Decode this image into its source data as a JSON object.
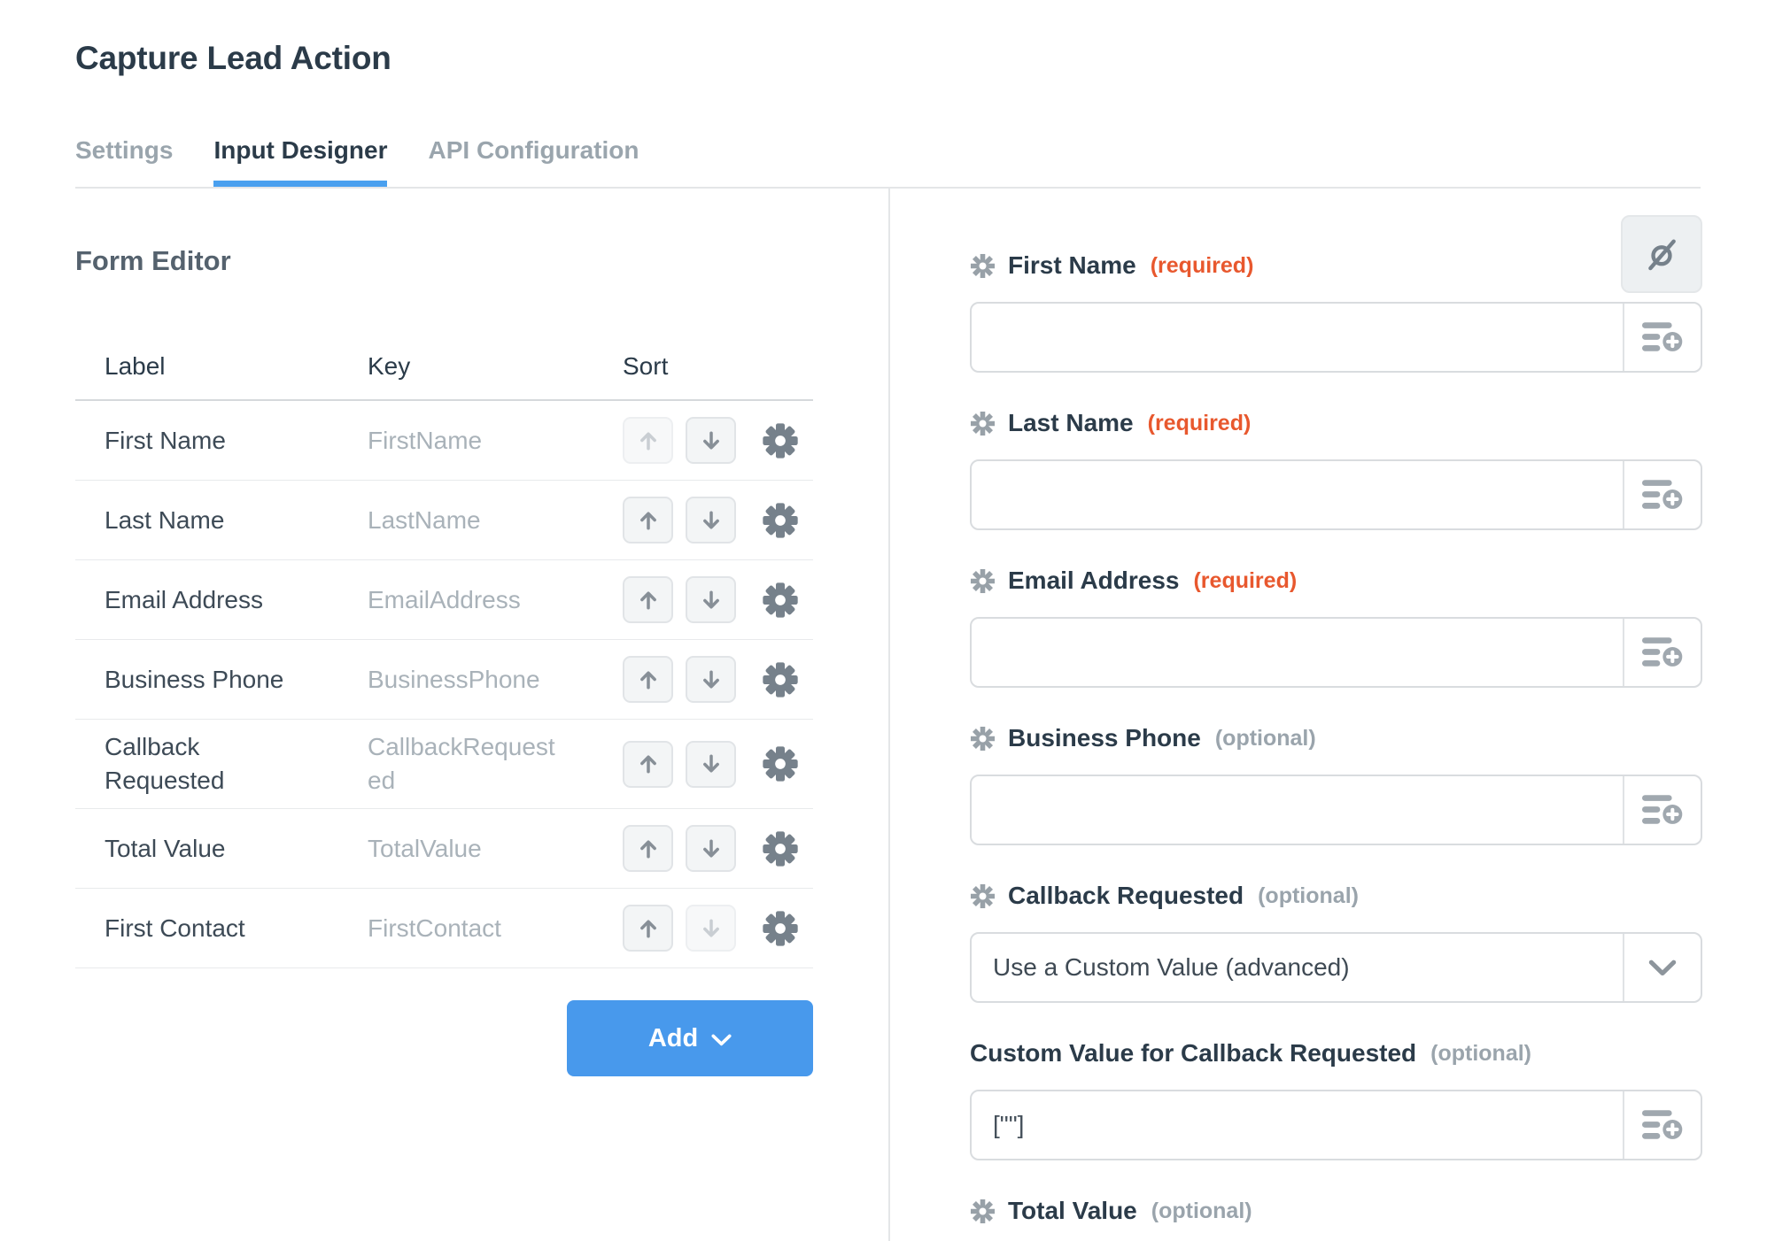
{
  "page": {
    "title": "Capture Lead Action"
  },
  "tabs": [
    {
      "label": "Settings",
      "active": false
    },
    {
      "label": "Input Designer",
      "active": true
    },
    {
      "label": "API Configuration",
      "active": false
    }
  ],
  "form_editor": {
    "heading": "Form Editor",
    "columns": {
      "label": "Label",
      "key": "Key",
      "sort": "Sort"
    },
    "rows": [
      {
        "label": "First Name",
        "key": "FirstName",
        "up_enabled": false,
        "down_enabled": true
      },
      {
        "label": "Last Name",
        "key": "LastName",
        "up_enabled": true,
        "down_enabled": true
      },
      {
        "label": "Email Address",
        "key": "EmailAddress",
        "up_enabled": true,
        "down_enabled": true
      },
      {
        "label": "Business Phone",
        "key": "BusinessPhone",
        "up_enabled": true,
        "down_enabled": true
      },
      {
        "label": "Callback Requested",
        "key": "CallbackRequested",
        "up_enabled": true,
        "down_enabled": true
      },
      {
        "label": "Total Value",
        "key": "TotalValue",
        "up_enabled": true,
        "down_enabled": true
      },
      {
        "label": "First Contact",
        "key": "FirstContact",
        "up_enabled": true,
        "down_enabled": false
      }
    ],
    "add_button": {
      "label": "Add"
    }
  },
  "preview": {
    "fields": [
      {
        "label": "First Name",
        "requirement": "(required)",
        "value": ""
      },
      {
        "label": "Last Name",
        "requirement": "(required)",
        "value": ""
      },
      {
        "label": "Email Address",
        "requirement": "(required)",
        "value": ""
      },
      {
        "label": "Business Phone",
        "requirement": "(optional)",
        "value": ""
      },
      {
        "label": "Callback Requested",
        "requirement": "(optional)",
        "value": "Use a Custom Value (advanced)"
      },
      {
        "label": "Custom Value for Callback Requested",
        "requirement": "(optional)",
        "value": "[\"\"]"
      },
      {
        "label": "Total Value",
        "requirement": "(optional)"
      }
    ]
  },
  "icons": {
    "asterisk": "field-mapping-asterisk",
    "hide_field": "eye-slash",
    "insert_field": "list-with-plus",
    "sort_up": "arrow-up",
    "sort_down": "arrow-down",
    "row_settings": "gear",
    "add_menu": "chevron-down",
    "select_open": "chevron-down"
  },
  "colors": {
    "accent_blue": "#4899ec",
    "tab_underline_blue": "#4aa0ef",
    "required_orange": "#e8582e",
    "optional_gray": "#9aa4ac",
    "heading_dark": "#2b3b49"
  }
}
